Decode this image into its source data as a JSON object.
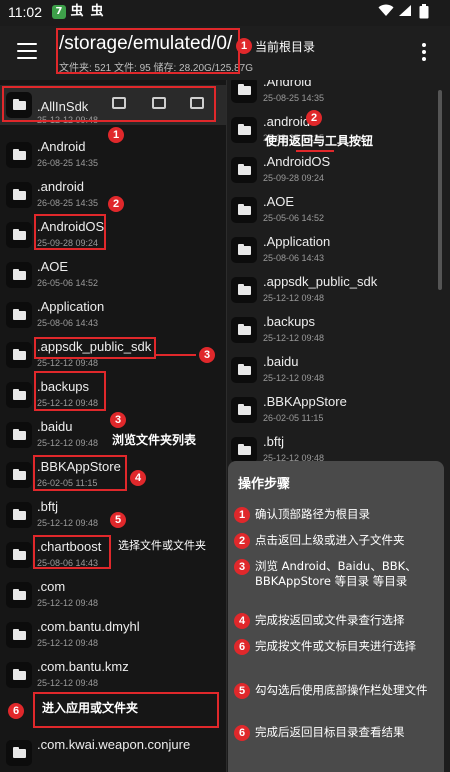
{
  "status_bar": {
    "time": "11:02",
    "app_icons": [
      "7",
      "虫",
      "虫"
    ],
    "app_icon_colors": [
      "#3ea04a",
      "#2b2b2b",
      "#2b2b2b"
    ],
    "system_icons": [
      "wifi-icon",
      "signal-icon",
      "battery-icon"
    ]
  },
  "toolbar": {
    "path": "/storage/emulated/0/",
    "info": "文件夹: 521  文件: 95  储存: 28.20G/125.87G",
    "path_caption": "当前根目录",
    "path_badge": "1"
  },
  "left_pane": {
    "items": [
      {
        "name": ".AllInSdk",
        "date": "25-12-12 09:48"
      },
      {
        "name": ".Android",
        "date": "26-08-25 14:35"
      },
      {
        "name": ".android",
        "date": "26-08-25 14:35"
      },
      {
        "name": ".AndroidOS",
        "date": "25-09-28 09:24"
      },
      {
        "name": ".AOE",
        "date": "26-05-06 14:52"
      },
      {
        "name": ".Application",
        "date": "25-08-06 14:43"
      },
      {
        "name": ".appsdk_public_sdk",
        "date": "25-12-12 09:48"
      },
      {
        "name": ".backups",
        "date": "25-12-12 09:48"
      },
      {
        "name": ".baidu",
        "date": "25-12-12 09:48"
      },
      {
        "name": ".BBKAppStore",
        "date": "26-02-05 11:15"
      },
      {
        "name": ".bftj",
        "date": "25-12-12 09:48"
      },
      {
        "name": ".chartboost",
        "date": "25-08-06 14:43"
      },
      {
        "name": ".com",
        "date": "25-12-12 09:48"
      },
      {
        "name": ".com.bantu.dmyhl",
        "date": "25-12-12 09:48"
      },
      {
        "name": ".com.bantu.kmz",
        "date": "25-12-12 09:48"
      },
      {
        "name": "",
        "date": ""
      },
      {
        "name": ".com.kwai.weapon.conjure",
        "date": ""
      }
    ]
  },
  "right_pane": {
    "items": [
      {
        "name": ".Android",
        "date": "25-08-25 14:35"
      },
      {
        "name": ".android",
        "date": "25-08-25 14:35"
      },
      {
        "name": ".AndroidOS",
        "date": "25-09-28 09:24"
      },
      {
        "name": ".AOE",
        "date": "25-05-06 14:52"
      },
      {
        "name": ".Application",
        "date": "25-08-06 14:43"
      },
      {
        "name": ".appsdk_public_sdk",
        "date": "25-12-12 09:48"
      },
      {
        "name": ".backups",
        "date": "25-12-12 09:48"
      },
      {
        "name": ".baidu",
        "date": "25-12-12 09:48"
      },
      {
        "name": ".BBKAppStore",
        "date": "26-02-05 11:15"
      },
      {
        "name": ".bftj",
        "date": "25-12-12 09:48"
      }
    ]
  },
  "annotations": {
    "back_tools": {
      "badge": "2",
      "text": "使用返回与工具按钮"
    },
    "browse": {
      "badge": "3",
      "text": "浏览文件夹列表"
    },
    "select": {
      "badge": "5",
      "text": "选择文件或文件夹"
    },
    "enter": {
      "badge": "6",
      "text": "进入应用或文件夹"
    },
    "badge_1": "1",
    "badge_2": "2",
    "badge_3": "3",
    "badge_4": "4"
  },
  "steps_panel": {
    "title": "操作步骤",
    "steps": [
      {
        "badge": "1",
        "text": "确认顶部路径为根目录"
      },
      {
        "badge": "2",
        "text": "点击返回上级或进入子文件夹"
      },
      {
        "badge": "3",
        "text": "浏览 Android、Baidu、BBK、BBKAppStore 等目录 等目录"
      },
      {
        "badge": "4",
        "text": "完成按返回或文件录查行选择"
      },
      {
        "badge": "6",
        "text": "完成按文件或文标目夹进行选择"
      },
      {
        "badge": "5",
        "text": "勾勾选后使用底部操作栏处理文件"
      },
      {
        "badge": "6",
        "text": "完成后返回目标目录查看结果"
      }
    ]
  },
  "colors": {
    "annotation_red": "#e0282b",
    "background": "#151515",
    "panel": "#4a4a4a"
  }
}
